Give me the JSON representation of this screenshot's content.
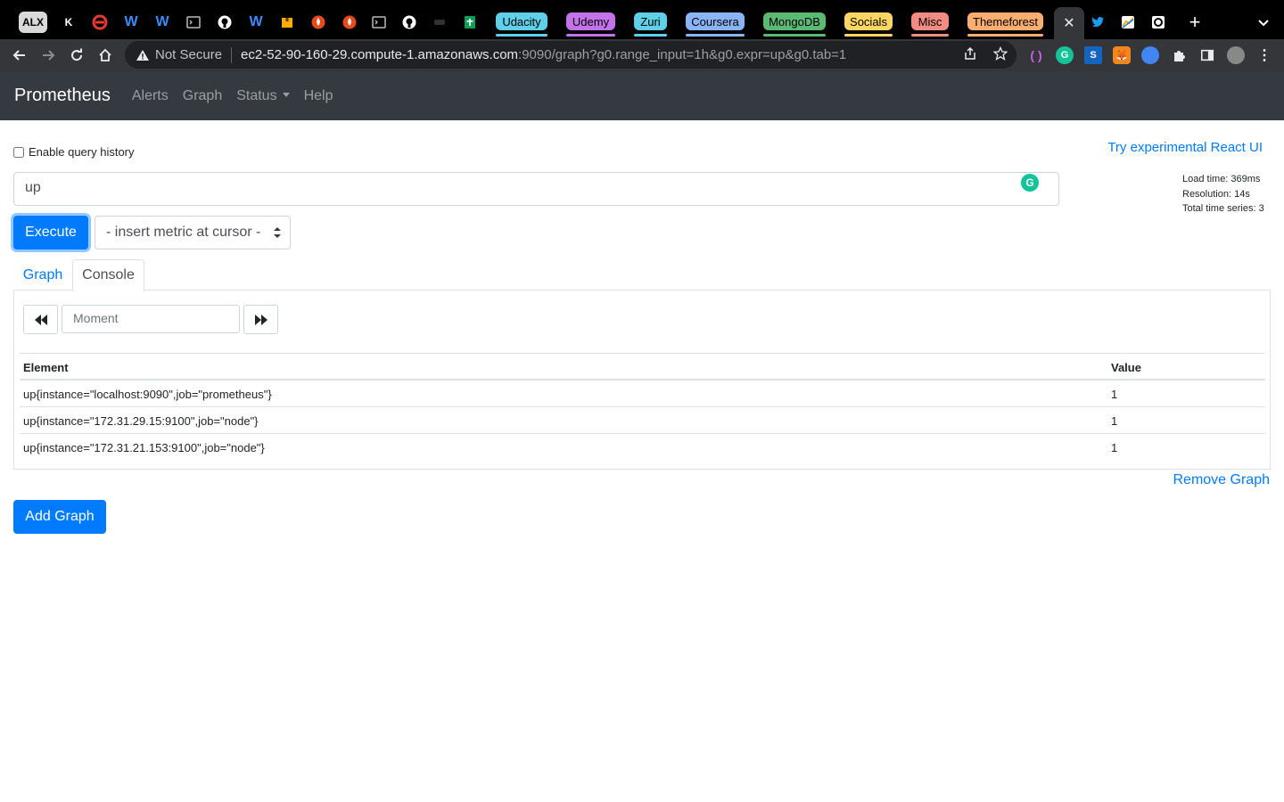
{
  "browser": {
    "pinned_tabs": [
      "ALX",
      "K",
      "W",
      "W",
      "W"
    ],
    "tab_groups": [
      {
        "label": "Udacity",
        "color": "#5fd0e8"
      },
      {
        "label": "Udemy",
        "color": "#c373ea"
      },
      {
        "label": "Zuri",
        "color": "#5fd0e8"
      },
      {
        "label": "Coursera",
        "color": "#8ab4f8"
      },
      {
        "label": "MongoDB",
        "color": "#5bb974"
      },
      {
        "label": "Socials",
        "color": "#fdd663"
      },
      {
        "label": "Misc",
        "color": "#f28b82"
      },
      {
        "label": "Themeforest",
        "color": "#fcad70"
      }
    ],
    "url": {
      "security": "Not Secure",
      "host": "ec2-52-90-160-29.compute-1.amazonaws.com",
      "path": ":9090/graph?g0.range_input=1h&g0.expr=up&g0.tab=1"
    }
  },
  "navbar": {
    "brand": "Prometheus",
    "links": [
      "Alerts",
      "Graph",
      "Status",
      "Help"
    ]
  },
  "query": {
    "history_label": "Enable query history",
    "react_link": "Try experimental React UI",
    "expression": "up",
    "execute_label": "Execute",
    "metric_select": "- insert metric at cursor -",
    "stats": {
      "load_time": "Load time: 369ms",
      "resolution": "Resolution: 14s",
      "total_series": "Total time series: 3"
    }
  },
  "tabs": {
    "graph": "Graph",
    "console": "Console"
  },
  "console": {
    "moment_placeholder": "Moment",
    "headers": {
      "element": "Element",
      "value": "Value"
    },
    "rows": [
      {
        "element": "up{instance=\"localhost:9090\",job=\"prometheus\"}",
        "value": "1"
      },
      {
        "element": "up{instance=\"172.31.29.15:9100\",job=\"node\"}",
        "value": "1"
      },
      {
        "element": "up{instance=\"172.31.21.153:9100\",job=\"node\"}",
        "value": "1"
      }
    ]
  },
  "actions": {
    "remove_graph": "Remove Graph",
    "add_graph": "Add Graph"
  }
}
